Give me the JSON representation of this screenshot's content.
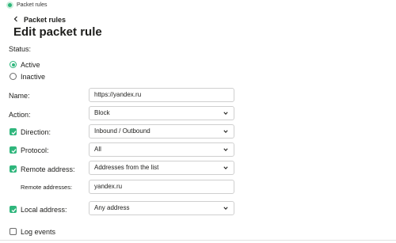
{
  "window": {
    "title": "Packet rules"
  },
  "breadcrumb": {
    "back_label": "Packet rules"
  },
  "page": {
    "title": "Edit packet rule"
  },
  "status": {
    "label": "Status:",
    "options": [
      {
        "label": "Active",
        "selected": true
      },
      {
        "label": "Inactive",
        "selected": false
      }
    ]
  },
  "form": {
    "name": {
      "label": "Name:",
      "value": "https://yandex.ru"
    },
    "action": {
      "label": "Action:",
      "value": "Block"
    },
    "direction": {
      "label": "Direction:",
      "checked": true,
      "value": "Inbound / Outbound"
    },
    "protocol": {
      "label": "Protocol:",
      "checked": true,
      "value": "All"
    },
    "remote_address": {
      "label": "Remote address:",
      "checked": true,
      "value": "Addresses from the list"
    },
    "remote_addresses": {
      "label": "Remote addresses:",
      "value": "yandex.ru"
    },
    "local_address": {
      "label": "Local address:",
      "checked": true,
      "value": "Any address"
    },
    "log_events": {
      "label": "Log events",
      "checked": false
    }
  },
  "colors": {
    "accent": "#2fb67c",
    "border": "#cfcfcf",
    "text": "#1d1d1b"
  },
  "icons": {
    "checkmark": "check-icon",
    "dropdown": "chevron-down-icon",
    "back": "chevron-left-icon",
    "app": "app-status-icon"
  }
}
